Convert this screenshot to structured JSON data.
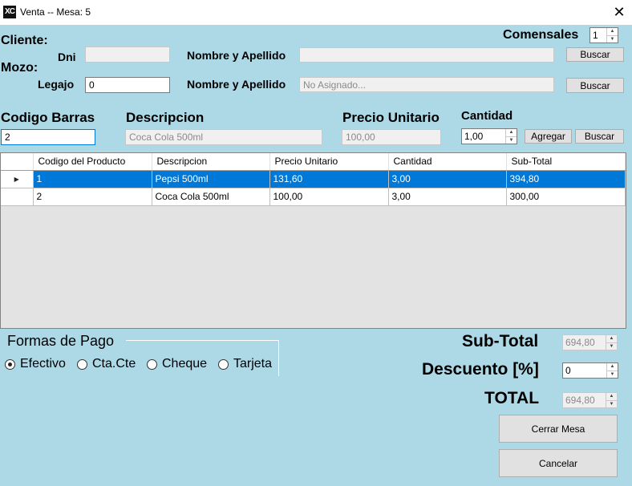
{
  "window": {
    "icon_text": "XC",
    "title": "Venta -- Mesa: 5",
    "close": "✕"
  },
  "cliente": {
    "section_label": "Cliente:",
    "dni_label": "Dni",
    "dni_value": "",
    "nombre_label": "Nombre y Apellido",
    "nombre_value": "",
    "buscar_label": "Buscar"
  },
  "comensales": {
    "label": "Comensales",
    "value": "1"
  },
  "mozo": {
    "section_label": "Mozo:",
    "legajo_label": "Legajo",
    "legajo_value": "0",
    "nombre_label": "Nombre y Apellido",
    "nombre_placeholder": "No  Asignado...",
    "buscar_label": "Buscar"
  },
  "producto": {
    "codigo_label": "Codigo Barras",
    "codigo_value": "2",
    "descripcion_label": "Descripcion",
    "descripcion_value": "Coca Cola 500ml",
    "precio_label": "Precio Unitario",
    "precio_value": "100,00",
    "cantidad_label": "Cantidad",
    "cantidad_value": "1,00",
    "agregar_label": "Agregar",
    "buscar_label": "Buscar"
  },
  "grid": {
    "columns": [
      "Codigo del Producto",
      "Descripcion",
      "Precio Unitario",
      "Cantidad",
      "Sub-Total"
    ],
    "rows": [
      {
        "codigo": "1",
        "descripcion": "Pepsi 500ml",
        "precio": "131,60",
        "cantidad": "3,00",
        "subtotal": "394,80",
        "selected": true
      },
      {
        "codigo": "2",
        "descripcion": "Coca Cola 500ml",
        "precio": "100,00",
        "cantidad": "3,00",
        "subtotal": "300,00",
        "selected": false
      }
    ],
    "row_marker": "▶"
  },
  "pago": {
    "title": "Formas de Pago",
    "options": [
      "Efectivo",
      "Cta.Cte",
      "Cheque",
      "Tarjeta"
    ],
    "selected": "Efectivo"
  },
  "totales": {
    "subtotal_label": "Sub-Total",
    "subtotal_value": "694,80",
    "descuento_label": "Descuento [%]",
    "descuento_value": "0",
    "total_label": "TOTAL",
    "total_value": "694,80"
  },
  "actions": {
    "cerrar_label": "Cerrar Mesa",
    "cancelar_label": "Cancelar"
  },
  "colors": {
    "background": "#add8e6",
    "selection": "#0078d7"
  }
}
